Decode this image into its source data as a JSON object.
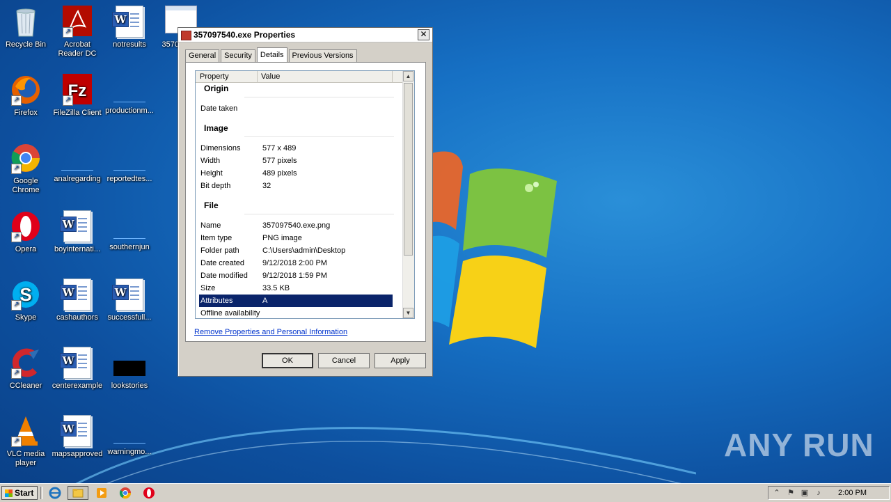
{
  "desktop": {
    "icons": [
      {
        "label": "Recycle Bin"
      },
      {
        "label": "Acrobat Reader DC"
      },
      {
        "label": "notresults"
      },
      {
        "label": "357097540"
      },
      {
        "label": "Firefox"
      },
      {
        "label": "FileZilla Client"
      },
      {
        "label": "productionm..."
      },
      {
        "label": "Google Chrome"
      },
      {
        "label": "analregarding"
      },
      {
        "label": "reportedtes..."
      },
      {
        "label": "Opera"
      },
      {
        "label": "boyinternati..."
      },
      {
        "label": "southernjun"
      },
      {
        "label": "Skype"
      },
      {
        "label": "cashauthors"
      },
      {
        "label": "successfull..."
      },
      {
        "label": "CCleaner"
      },
      {
        "label": "centerexample"
      },
      {
        "label": "lookstories"
      },
      {
        "label": "VLC media player"
      },
      {
        "label": "mapsapproved"
      },
      {
        "label": "warningmo..."
      }
    ]
  },
  "dialog": {
    "title": "357097540.exe Properties",
    "close_glyph": "✕",
    "tabs": [
      "General",
      "Security",
      "Details",
      "Previous Versions"
    ],
    "active_tab": "Details",
    "columns": {
      "property": "Property",
      "value": "Value"
    },
    "groups": {
      "origin": "Origin",
      "image": "Image",
      "file": "File"
    },
    "rows": {
      "date_taken": {
        "k": "Date taken",
        "v": ""
      },
      "dimensions": {
        "k": "Dimensions",
        "v": "577 x 489"
      },
      "width": {
        "k": "Width",
        "v": "577 pixels"
      },
      "height": {
        "k": "Height",
        "v": "489 pixels"
      },
      "bit_depth": {
        "k": "Bit depth",
        "v": "32"
      },
      "name": {
        "k": "Name",
        "v": "357097540.exe.png"
      },
      "item_type": {
        "k": "Item type",
        "v": "PNG image"
      },
      "folder_path": {
        "k": "Folder path",
        "v": "C:\\Users\\admin\\Desktop"
      },
      "date_created": {
        "k": "Date created",
        "v": "9/12/2018 2:00 PM"
      },
      "date_modified": {
        "k": "Date modified",
        "v": "9/12/2018 1:59 PM"
      },
      "size": {
        "k": "Size",
        "v": "33.5 KB"
      },
      "attributes": {
        "k": "Attributes",
        "v": "A"
      },
      "offline": {
        "k": "Offline availability",
        "v": ""
      }
    },
    "remove_link": "Remove Properties and Personal Information",
    "buttons": {
      "ok": "OK",
      "cancel": "Cancel",
      "apply": "Apply"
    }
  },
  "taskbar": {
    "start_label": "Start",
    "clock": "2:00 PM"
  },
  "watermark": "ANY RUN",
  "colors": {
    "selection": "#0a246a",
    "link": "#0033cc"
  }
}
